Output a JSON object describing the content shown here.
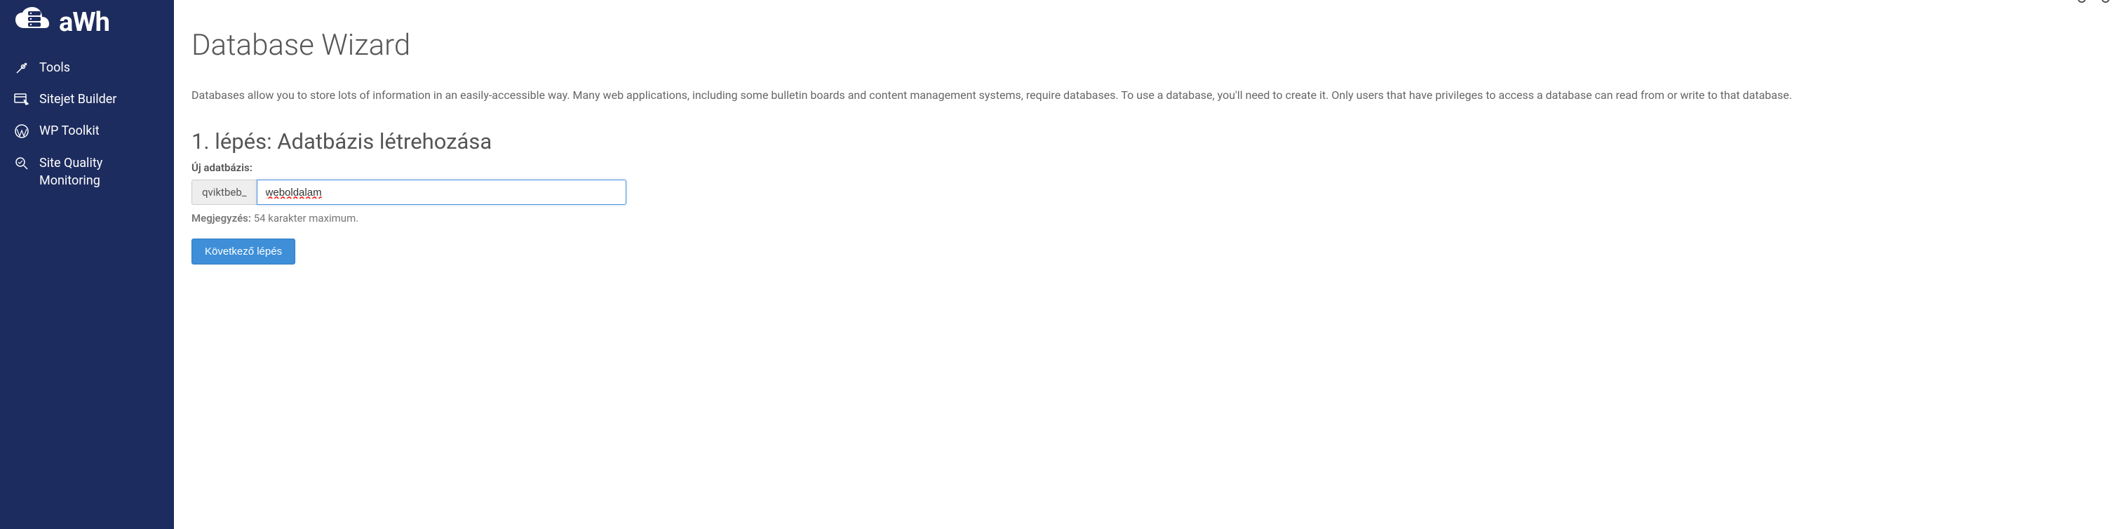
{
  "logo": {
    "text": "aWh"
  },
  "sidebar": {
    "items": [
      {
        "label": "Tools",
        "icon": "tools"
      },
      {
        "label": "Sitejet Builder",
        "icon": "sitejet"
      },
      {
        "label": "WP Toolkit",
        "icon": "wordpress"
      },
      {
        "label": "Site Quality Monitoring",
        "icon": "monitor"
      }
    ]
  },
  "main": {
    "title": "Database Wizard",
    "description": "Databases allow you to store lots of information in an easily-accessible way. Many web applications, including some bulletin boards and content management systems, require databases. To use a database, you'll need to create it. Only users that have privileges to access a database can read from or write to that database.",
    "step_title": "1. lépés: Adatbázis létrehozása",
    "field_label": "Új adatbázis:",
    "prefix": "qviktbeb_",
    "input_value": "weboldalam",
    "note_label": "Megjegyzés:",
    "note_text": " 54 karakter maximum.",
    "button_label": "Következő lépés"
  }
}
